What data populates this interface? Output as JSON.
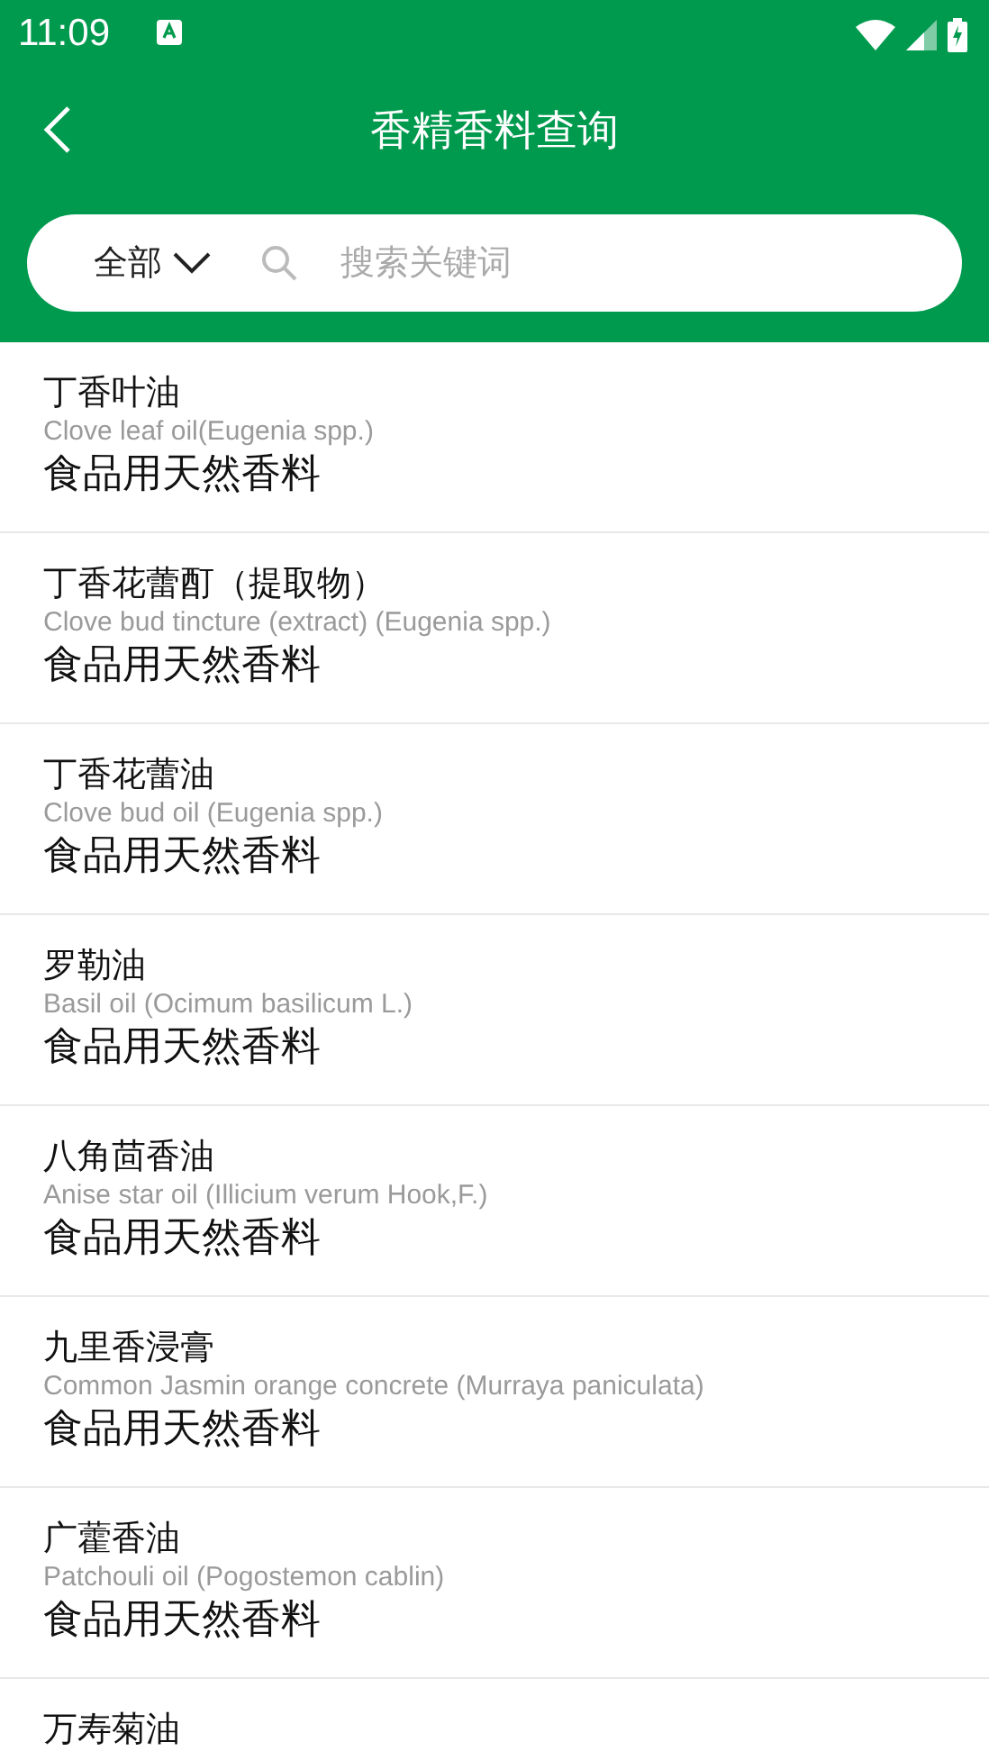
{
  "status_bar": {
    "time": "11:09"
  },
  "header": {
    "title": "香精香料查询"
  },
  "search": {
    "filter": "全部",
    "placeholder": "搜索关键词"
  },
  "items": [
    {
      "name": "丁香叶油",
      "english": "Clove leaf oil(Eugenia spp.)",
      "category": "食品用天然香料"
    },
    {
      "name": "丁香花蕾酊（提取物）",
      "english": "Clove bud tincture (extract) (Eugenia spp.)",
      "category": "食品用天然香料"
    },
    {
      "name": "丁香花蕾油",
      "english": "Clove bud oil (Eugenia spp.)",
      "category": "食品用天然香料"
    },
    {
      "name": "罗勒油",
      "english": "Basil oil (Ocimum basilicum L.)",
      "category": "食品用天然香料"
    },
    {
      "name": "八角茴香油",
      "english": "Anise star oil (Illicium verum Hook,F.)",
      "category": "食品用天然香料"
    },
    {
      "name": "九里香浸膏",
      "english": "Common Jasmin orange concrete (Murraya paniculata)",
      "category": "食品用天然香料"
    },
    {
      "name": "广藿香油",
      "english": "Patchouli oil (Pogostemon cablin)",
      "category": "食品用天然香料"
    },
    {
      "name": "万寿菊油"
    }
  ]
}
